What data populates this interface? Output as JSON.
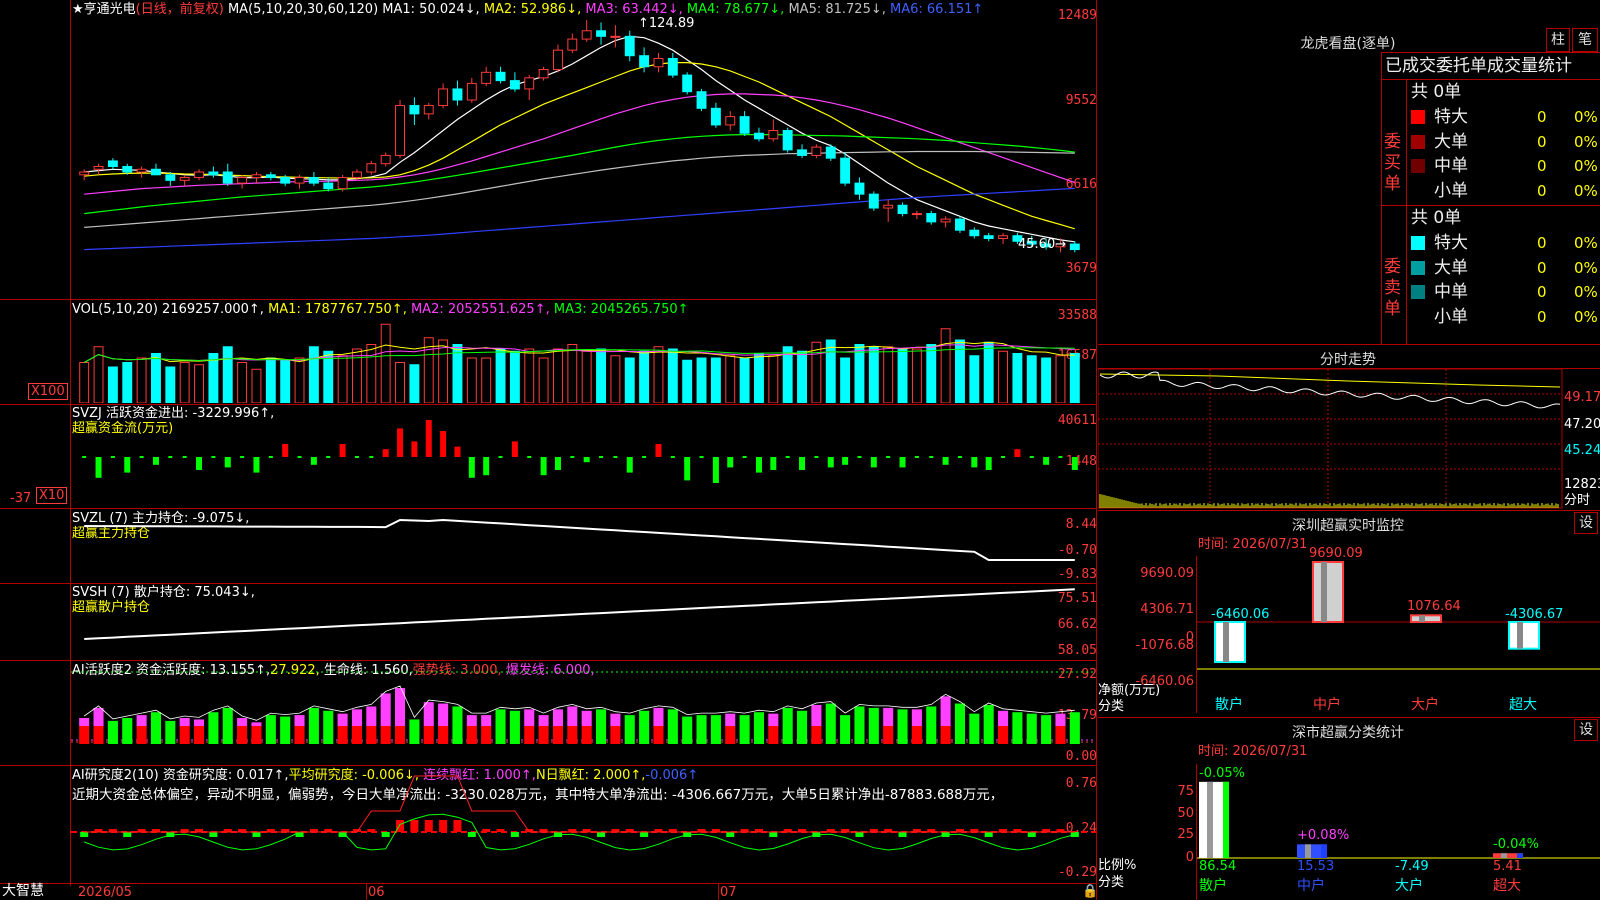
{
  "header": {
    "star": "★",
    "stock_name": "亨通光电",
    "period": "(日线，前复权)",
    "ma_label": "MA(5,10,20,30,60,120)",
    "ma_values": [
      {
        "label": "MA1: 50.024↓,",
        "color": "#ffffff"
      },
      {
        "label": "MA2: 52.986↓,",
        "color": "#ffff00"
      },
      {
        "label": "MA3: 63.442↓,",
        "color": "#ff40ff"
      },
      {
        "label": "MA4: 78.677↓,",
        "color": "#00ff00"
      },
      {
        "label": "MA5: 81.725↓,",
        "color": "#c0c0c0"
      },
      {
        "label": "MA6: 66.151↑",
        "color": "#4060ff"
      }
    ],
    "high_mark": "124.89",
    "low_mark": "45.60"
  },
  "price_axis": [
    "12489",
    "9552",
    "6616",
    "3679"
  ],
  "vol_panel": {
    "title": "VOL(5,10,20)",
    "value": "2169257.000↑,",
    "ma1": "MA1: 1787767.750↑,",
    "ma2": "MA2: 2052551.625↑,",
    "ma3": "MA3: 2045265.750↑",
    "axis": [
      "33588",
      "16587"
    ],
    "unit": "X100"
  },
  "svzj_panel": {
    "title": "SVZJ 活跃资金进出: -3229.996↑,",
    "sub": "超赢资金流(万元)",
    "axis": [
      "40611",
      "1448",
      "-37"
    ],
    "unit": "X10"
  },
  "svzl_panel": {
    "title": "SVZL (7) 主力持仓: -9.075↓,",
    "sub": "超赢主力持仓",
    "axis": [
      "8.44",
      "-0.70",
      "-9.83"
    ]
  },
  "svsh_panel": {
    "title": "SVSH (7) 散户持仓: 75.043↓,",
    "sub": "超赢散户持仓",
    "axis": [
      "75.51",
      "66.62",
      "58.05"
    ]
  },
  "ai_active": {
    "title": "AI活跃度2 资金活跃度: 13.155↑,",
    "v2": "27.922,",
    "life": "生命线: 1.560,",
    "strong": "强势线: 3.000,",
    "burst": "爆发线: 6.000,",
    "axis": [
      "27.92",
      "13.79",
      "0.00"
    ]
  },
  "ai_research": {
    "title": "AI研究度2(10) 资金研究度: 0.017↑,",
    "avg": "平均研究度: -0.006↓,",
    "red": "连续飘红: 1.000↑,",
    "nred": "N日飘红: 2.000↑,",
    "last": "-0.006↑",
    "comment": "近期大资金总体偏空，异动不明显，偏弱势，今日大单净流出: -3230.028万元，其中特大单净流出: -4306.667万元，大单5日累计净出-87883.688万元，",
    "axis": [
      "0.76",
      "0.24",
      "-0.29"
    ]
  },
  "bottom_axis": {
    "brand": "大智慧",
    "labels": [
      "2026/05",
      "06",
      "07"
    ]
  },
  "dragon_panel": {
    "title": "龙虎看盘(逐单)",
    "btn1": "柱",
    "btn2": "笔",
    "tabs": "已成交委托单成交量统计",
    "buy_label": "委买单",
    "sell_label": "委卖单",
    "buy_total": "共 0单",
    "sell_total": "共 0单",
    "buy_rows": [
      {
        "name": "特大",
        "count": "0",
        "pct": "0%",
        "color": "#ff0000"
      },
      {
        "name": "大单",
        "count": "0",
        "pct": "0%",
        "color": "#a00000"
      },
      {
        "name": "中单",
        "count": "0",
        "pct": "0%",
        "color": "#700000"
      },
      {
        "name": "小单",
        "count": "0",
        "pct": "0%",
        "color": ""
      }
    ],
    "sell_rows": [
      {
        "name": "特大",
        "count": "0",
        "pct": "0%",
        "color": "#00ffff"
      },
      {
        "name": "大单",
        "count": "0",
        "pct": "0%",
        "color": "#00a0a0"
      },
      {
        "name": "中单",
        "count": "0",
        "pct": "0%",
        "color": "#008080"
      },
      {
        "name": "小单",
        "count": "0",
        "pct": "0%",
        "color": ""
      }
    ]
  },
  "intraday": {
    "title": "分时走势",
    "axis": [
      "49.17",
      "47.20",
      "45.24",
      "12823"
    ],
    "unit": "分时"
  },
  "sz_monitor": {
    "title": "深圳超赢实时监控",
    "btn": "设",
    "time": "时间: 2026/07/31",
    "axis": [
      "9690.09",
      "4306.71",
      "0",
      "-1076.68",
      "-6460.06"
    ],
    "footer1": "净额(万元)",
    "footer2": "分类",
    "bars": [
      {
        "cat": "散户",
        "value": -6460.06,
        "label": "-6460.06"
      },
      {
        "cat": "中户",
        "value": 9690.09,
        "label": "9690.09"
      },
      {
        "cat": "大户",
        "value": 1076.64,
        "label": "1076.64"
      },
      {
        "cat": "超大",
        "value": -4306.67,
        "label": "-4306.67"
      }
    ]
  },
  "sz_class": {
    "title": "深市超赢分类统计",
    "btn": "设",
    "time": "时间: 2026/07/31",
    "axis": [
      "75",
      "50",
      "25",
      "0"
    ],
    "footer1": "比例%",
    "footer2": "分类",
    "bars": [
      {
        "cat": "散户",
        "value": 86.54,
        "change": "-0.05%",
        "label": "86.54"
      },
      {
        "cat": "中户",
        "value": 15.53,
        "change": "+0.08%",
        "label": "15.53"
      },
      {
        "cat": "大户",
        "value": -7.49,
        "change": "",
        "label": "-7.49"
      },
      {
        "cat": "超大",
        "value": 5.41,
        "change": "-0.04%",
        "label": "5.41"
      }
    ]
  },
  "chart_data": {
    "type": "candlestick",
    "title": "亨通光电 日线 前复权",
    "x_range": [
      "2026/05",
      "2026/07/31"
    ],
    "y_range": [
      3679,
      12489
    ],
    "candles": [
      [
        6900,
        7100,
        6700,
        7000
      ],
      [
        7100,
        7300,
        6900,
        7200
      ],
      [
        7400,
        7500,
        7100,
        7200
      ],
      [
        7200,
        7300,
        6900,
        7000
      ],
      [
        7000,
        7200,
        6800,
        7100
      ],
      [
        7100,
        7300,
        6900,
        6900
      ],
      [
        6900,
        7000,
        6500,
        6700
      ],
      [
        6700,
        6900,
        6500,
        6800
      ],
      [
        6800,
        7100,
        6700,
        7000
      ],
      [
        7000,
        7200,
        6800,
        6900
      ],
      [
        7000,
        7300,
        6500,
        6600
      ],
      [
        6600,
        6900,
        6400,
        6800
      ],
      [
        6800,
        7000,
        6600,
        6900
      ],
      [
        6900,
        7000,
        6700,
        6800
      ],
      [
        6800,
        6900,
        6500,
        6600
      ],
      [
        6600,
        6900,
        6400,
        6800
      ],
      [
        6800,
        7000,
        6500,
        6600
      ],
      [
        6600,
        6800,
        6300,
        6400
      ],
      [
        6400,
        6900,
        6300,
        6800
      ],
      [
        6800,
        7100,
        6700,
        7000
      ],
      [
        7000,
        7400,
        6900,
        7300
      ],
      [
        7300,
        7700,
        7200,
        7600
      ],
      [
        7600,
        9600,
        7500,
        9400
      ],
      [
        9400,
        9700,
        8700,
        9100
      ],
      [
        9100,
        9500,
        8900,
        9400
      ],
      [
        9400,
        10200,
        9300,
        10000
      ],
      [
        10000,
        10300,
        9400,
        9600
      ],
      [
        9600,
        10400,
        9500,
        10200
      ],
      [
        10200,
        10800,
        10100,
        10600
      ],
      [
        10600,
        10800,
        10200,
        10300
      ],
      [
        10300,
        10600,
        9900,
        10000
      ],
      [
        10000,
        10500,
        9600,
        10400
      ],
      [
        10400,
        10800,
        10300,
        10700
      ],
      [
        10700,
        11600,
        10600,
        11400
      ],
      [
        11400,
        12000,
        11300,
        11800
      ],
      [
        11800,
        12489,
        11700,
        12100
      ],
      [
        12100,
        12400,
        11600,
        11900
      ],
      [
        11900,
        12300,
        11500,
        11900
      ],
      [
        11900,
        12100,
        11000,
        11200
      ],
      [
        11200,
        11500,
        10600,
        10800
      ],
      [
        10800,
        11300,
        10600,
        11100
      ],
      [
        11100,
        11300,
        10400,
        10500
      ],
      [
        10500,
        10600,
        9800,
        9900
      ],
      [
        9900,
        10000,
        9200,
        9300
      ],
      [
        9300,
        9500,
        8600,
        8700
      ],
      [
        8700,
        9200,
        8500,
        9000
      ],
      [
        9000,
        9200,
        8300,
        8400
      ],
      [
        8400,
        8600,
        8100,
        8200
      ],
      [
        8200,
        8900,
        8100,
        8500
      ],
      [
        8500,
        8600,
        7700,
        7800
      ],
      [
        7800,
        8000,
        7500,
        7600
      ],
      [
        7600,
        8000,
        7500,
        7900
      ],
      [
        7900,
        8000,
        7400,
        7500
      ],
      [
        7500,
        7700,
        6500,
        6600
      ],
      [
        6600,
        6800,
        6000,
        6200
      ],
      [
        6200,
        6300,
        5600,
        5700
      ],
      [
        5700,
        6000,
        5200,
        5800
      ],
      [
        5800,
        5900,
        5400,
        5500
      ],
      [
        5500,
        5600,
        5300,
        5500
      ],
      [
        5500,
        5600,
        5100,
        5200
      ],
      [
        5200,
        5400,
        5000,
        5300
      ],
      [
        5300,
        5400,
        4800,
        4900
      ],
      [
        4900,
        5000,
        4600,
        4700
      ],
      [
        4700,
        4800,
        4500,
        4600
      ],
      [
        4600,
        4800,
        4400,
        4700
      ],
      [
        4700,
        4800,
        4400,
        4500
      ],
      [
        4500,
        4700,
        4300,
        4400
      ],
      [
        4400,
        4600,
        4200,
        4300
      ],
      [
        4300,
        4600,
        4100,
        4400
      ],
      [
        4400,
        4500,
        4100,
        4200
      ]
    ],
    "ma_series": [
      {
        "name": "MA1",
        "color": "#ffffff",
        "values": [
          7000,
          7050,
          7100,
          7080,
          7060,
          7000,
          6950,
          6900,
          6880,
          6900,
          6850,
          6800,
          6800,
          6820,
          6780,
          6760,
          6740,
          6720,
          6720,
          6760,
          6820,
          6950,
          7350,
          7700,
          8100,
          8500,
          8900,
          9250,
          9600,
          9900,
          10150,
          10300,
          10450,
          10650,
          10900,
          11200,
          11500,
          11750,
          11900,
          11850,
          11650,
          11400,
          11050,
          10700,
          10300,
          9950,
          9600,
          9300,
          9000,
          8700,
          8400,
          8150,
          7950,
          7650,
          7300,
          6950,
          6600,
          6300,
          6000,
          5800,
          5600,
          5400,
          5200,
          5050,
          4950,
          4850,
          4750,
          4650,
          4550,
          4480
        ]
      },
      {
        "name": "MA2",
        "color": "#ffff00",
        "values": [
          6850,
          6900,
          6930,
          6950,
          6960,
          6960,
          6950,
          6930,
          6920,
          6910,
          6890,
          6870,
          6850,
          6830,
          6820,
          6810,
          6800,
          6790,
          6780,
          6780,
          6790,
          6820,
          6900,
          7050,
          7250,
          7500,
          7800,
          8100,
          8400,
          8700,
          8950,
          9200,
          9450,
          9650,
          9850,
          10050,
          10250,
          10450,
          10650,
          10800,
          10900,
          10950,
          10950,
          10900,
          10800,
          10650,
          10450,
          10250,
          10000,
          9750,
          9500,
          9250,
          9000,
          8700,
          8400,
          8100,
          7800,
          7500,
          7200,
          6950,
          6700,
          6450,
          6200,
          6000,
          5800,
          5600,
          5400,
          5250,
          5100,
          4950
        ]
      },
      {
        "name": "MA3",
        "color": "#ff40ff",
        "values": [
          6200,
          6250,
          6300,
          6350,
          6400,
          6430,
          6460,
          6490,
          6520,
          6540,
          6560,
          6580,
          6600,
          6620,
          6640,
          6650,
          6660,
          6670,
          6680,
          6700,
          6720,
          6760,
          6820,
          6900,
          7000,
          7120,
          7260,
          7400,
          7560,
          7720,
          7880,
          8040,
          8200,
          8380,
          8560,
          8740,
          8920,
          9100,
          9250,
          9400,
          9520,
          9620,
          9700,
          9760,
          9800,
          9820,
          9820,
          9800,
          9780,
          9740,
          9680,
          9600,
          9500,
          9380,
          9250,
          9100,
          8950,
          8780,
          8600,
          8420,
          8240,
          8060,
          7880,
          7700,
          7520,
          7340,
          7160,
          6980,
          6800,
          6620
        ]
      },
      {
        "name": "MA4",
        "color": "#00ff00",
        "values": [
          5500,
          5560,
          5620,
          5680,
          5740,
          5800,
          5850,
          5900,
          5950,
          6000,
          6050,
          6100,
          6140,
          6180,
          6220,
          6260,
          6300,
          6340,
          6380,
          6420,
          6460,
          6510,
          6570,
          6640,
          6720,
          6800,
          6880,
          6970,
          7060,
          7150,
          7240,
          7330,
          7420,
          7510,
          7600,
          7700,
          7800,
          7900,
          7990,
          8070,
          8140,
          8200,
          8250,
          8290,
          8320,
          8340,
          8350,
          8350,
          8350,
          8340,
          8330,
          8320,
          8310,
          8300,
          8280,
          8260,
          8240,
          8220,
          8200,
          8170,
          8140,
          8100,
          8060,
          8020,
          7980,
          7940,
          7890,
          7840,
          7780,
          7720
        ]
      },
      {
        "name": "MA5",
        "color": "#c0c0c0",
        "values": [
          5000,
          5040,
          5080,
          5120,
          5160,
          5200,
          5240,
          5280,
          5320,
          5360,
          5400,
          5440,
          5480,
          5520,
          5560,
          5600,
          5640,
          5680,
          5720,
          5760,
          5800,
          5850,
          5910,
          5980,
          6050,
          6130,
          6210,
          6300,
          6390,
          6480,
          6570,
          6660,
          6750,
          6830,
          6910,
          6990,
          7070,
          7140,
          7210,
          7280,
          7340,
          7400,
          7450,
          7500,
          7540,
          7570,
          7600,
          7620,
          7640,
          7660,
          7670,
          7680,
          7690,
          7700,
          7710,
          7720,
          7730,
          7730,
          7740,
          7740,
          7740,
          7740,
          7740,
          7730,
          7730,
          7720,
          7710,
          7700,
          7690,
          7680
        ]
      },
      {
        "name": "MA6",
        "color": "#3040ff",
        "values": [
          4200,
          4220,
          4240,
          4260,
          4280,
          4300,
          4320,
          4340,
          4360,
          4380,
          4400,
          4420,
          4440,
          4460,
          4480,
          4500,
          4520,
          4540,
          4560,
          4580,
          4600,
          4630,
          4660,
          4690,
          4720,
          4760,
          4800,
          4840,
          4880,
          4920,
          4960,
          5000,
          5040,
          5080,
          5120,
          5160,
          5200,
          5240,
          5280,
          5320,
          5360,
          5400,
          5440,
          5480,
          5520,
          5560,
          5600,
          5640,
          5680,
          5720,
          5760,
          5800,
          5840,
          5880,
          5920,
          5960,
          6000,
          6040,
          6080,
          6110,
          6140,
          6170,
          6200,
          6230,
          6260,
          6290,
          6320,
          6350,
          6380,
          6410
        ]
      }
    ],
    "volume": [
      180,
      250,
      160,
      180,
      200,
      220,
      160,
      180,
      170,
      220,
      250,
      180,
      150,
      200,
      190,
      200,
      250,
      230,
      210,
      240,
      260,
      350,
      180,
      170,
      290,
      280,
      260,
      200,
      200,
      240,
      230,
      240,
      200,
      240,
      260,
      230,
      240,
      210,
      200,
      230,
      250,
      240,
      190,
      200,
      200,
      210,
      200,
      220,
      210,
      250,
      230,
      270,
      280,
      200,
      260,
      250,
      250,
      240,
      240,
      260,
      330,
      280,
      210,
      270,
      230,
      220,
      210,
      200,
      210,
      220
    ],
    "fund_flow": [
      0,
      -8,
      0,
      -6,
      0,
      -3,
      0,
      0,
      -5,
      0,
      -4,
      0,
      -6,
      0,
      5,
      0,
      -3,
      0,
      5,
      0,
      0,
      3,
      11,
      6,
      16,
      10,
      4,
      -8,
      -7,
      0,
      6,
      0,
      -7,
      -5,
      0,
      -2,
      0,
      0,
      -6,
      0,
      5,
      0,
      -9,
      0,
      -10,
      -4,
      0,
      -6,
      -5,
      0,
      -5,
      0,
      -4,
      -3,
      0,
      -4,
      0,
      -4,
      0,
      0,
      -3,
      0,
      -4,
      -5,
      0,
      3,
      0,
      -3,
      0,
      -5
    ]
  }
}
